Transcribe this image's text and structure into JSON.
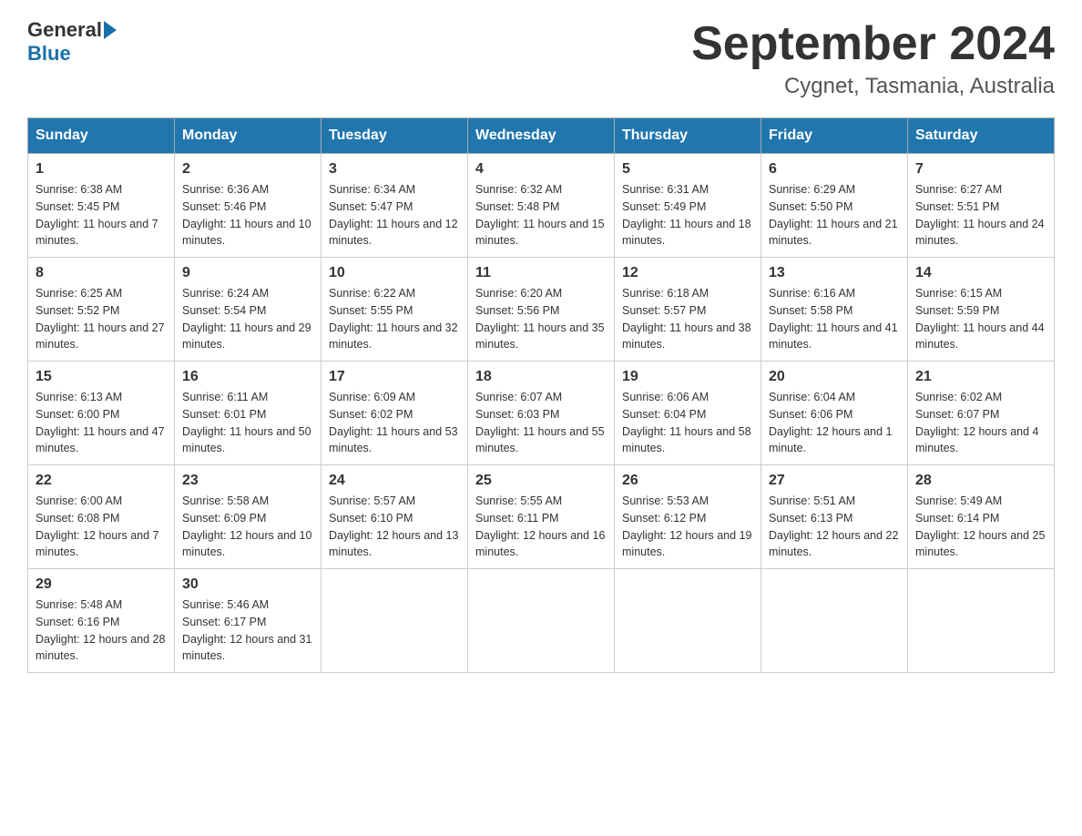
{
  "header": {
    "logo_general": "General",
    "logo_blue": "Blue",
    "title": "September 2024",
    "subtitle": "Cygnet, Tasmania, Australia"
  },
  "columns": [
    "Sunday",
    "Monday",
    "Tuesday",
    "Wednesday",
    "Thursday",
    "Friday",
    "Saturday"
  ],
  "weeks": [
    [
      {
        "day": "1",
        "sunrise": "6:38 AM",
        "sunset": "5:45 PM",
        "daylight": "11 hours and 7 minutes."
      },
      {
        "day": "2",
        "sunrise": "6:36 AM",
        "sunset": "5:46 PM",
        "daylight": "11 hours and 10 minutes."
      },
      {
        "day": "3",
        "sunrise": "6:34 AM",
        "sunset": "5:47 PM",
        "daylight": "11 hours and 12 minutes."
      },
      {
        "day": "4",
        "sunrise": "6:32 AM",
        "sunset": "5:48 PM",
        "daylight": "11 hours and 15 minutes."
      },
      {
        "day": "5",
        "sunrise": "6:31 AM",
        "sunset": "5:49 PM",
        "daylight": "11 hours and 18 minutes."
      },
      {
        "day": "6",
        "sunrise": "6:29 AM",
        "sunset": "5:50 PM",
        "daylight": "11 hours and 21 minutes."
      },
      {
        "day": "7",
        "sunrise": "6:27 AM",
        "sunset": "5:51 PM",
        "daylight": "11 hours and 24 minutes."
      }
    ],
    [
      {
        "day": "8",
        "sunrise": "6:25 AM",
        "sunset": "5:52 PM",
        "daylight": "11 hours and 27 minutes."
      },
      {
        "day": "9",
        "sunrise": "6:24 AM",
        "sunset": "5:54 PM",
        "daylight": "11 hours and 29 minutes."
      },
      {
        "day": "10",
        "sunrise": "6:22 AM",
        "sunset": "5:55 PM",
        "daylight": "11 hours and 32 minutes."
      },
      {
        "day": "11",
        "sunrise": "6:20 AM",
        "sunset": "5:56 PM",
        "daylight": "11 hours and 35 minutes."
      },
      {
        "day": "12",
        "sunrise": "6:18 AM",
        "sunset": "5:57 PM",
        "daylight": "11 hours and 38 minutes."
      },
      {
        "day": "13",
        "sunrise": "6:16 AM",
        "sunset": "5:58 PM",
        "daylight": "11 hours and 41 minutes."
      },
      {
        "day": "14",
        "sunrise": "6:15 AM",
        "sunset": "5:59 PM",
        "daylight": "11 hours and 44 minutes."
      }
    ],
    [
      {
        "day": "15",
        "sunrise": "6:13 AM",
        "sunset": "6:00 PM",
        "daylight": "11 hours and 47 minutes."
      },
      {
        "day": "16",
        "sunrise": "6:11 AM",
        "sunset": "6:01 PM",
        "daylight": "11 hours and 50 minutes."
      },
      {
        "day": "17",
        "sunrise": "6:09 AM",
        "sunset": "6:02 PM",
        "daylight": "11 hours and 53 minutes."
      },
      {
        "day": "18",
        "sunrise": "6:07 AM",
        "sunset": "6:03 PM",
        "daylight": "11 hours and 55 minutes."
      },
      {
        "day": "19",
        "sunrise": "6:06 AM",
        "sunset": "6:04 PM",
        "daylight": "11 hours and 58 minutes."
      },
      {
        "day": "20",
        "sunrise": "6:04 AM",
        "sunset": "6:06 PM",
        "daylight": "12 hours and 1 minute."
      },
      {
        "day": "21",
        "sunrise": "6:02 AM",
        "sunset": "6:07 PM",
        "daylight": "12 hours and 4 minutes."
      }
    ],
    [
      {
        "day": "22",
        "sunrise": "6:00 AM",
        "sunset": "6:08 PM",
        "daylight": "12 hours and 7 minutes."
      },
      {
        "day": "23",
        "sunrise": "5:58 AM",
        "sunset": "6:09 PM",
        "daylight": "12 hours and 10 minutes."
      },
      {
        "day": "24",
        "sunrise": "5:57 AM",
        "sunset": "6:10 PM",
        "daylight": "12 hours and 13 minutes."
      },
      {
        "day": "25",
        "sunrise": "5:55 AM",
        "sunset": "6:11 PM",
        "daylight": "12 hours and 16 minutes."
      },
      {
        "day": "26",
        "sunrise": "5:53 AM",
        "sunset": "6:12 PM",
        "daylight": "12 hours and 19 minutes."
      },
      {
        "day": "27",
        "sunrise": "5:51 AM",
        "sunset": "6:13 PM",
        "daylight": "12 hours and 22 minutes."
      },
      {
        "day": "28",
        "sunrise": "5:49 AM",
        "sunset": "6:14 PM",
        "daylight": "12 hours and 25 minutes."
      }
    ],
    [
      {
        "day": "29",
        "sunrise": "5:48 AM",
        "sunset": "6:16 PM",
        "daylight": "12 hours and 28 minutes."
      },
      {
        "day": "30",
        "sunrise": "5:46 AM",
        "sunset": "6:17 PM",
        "daylight": "12 hours and 31 minutes."
      },
      null,
      null,
      null,
      null,
      null
    ]
  ],
  "labels": {
    "sunrise_prefix": "Sunrise: ",
    "sunset_prefix": "Sunset: ",
    "daylight_prefix": "Daylight: "
  }
}
